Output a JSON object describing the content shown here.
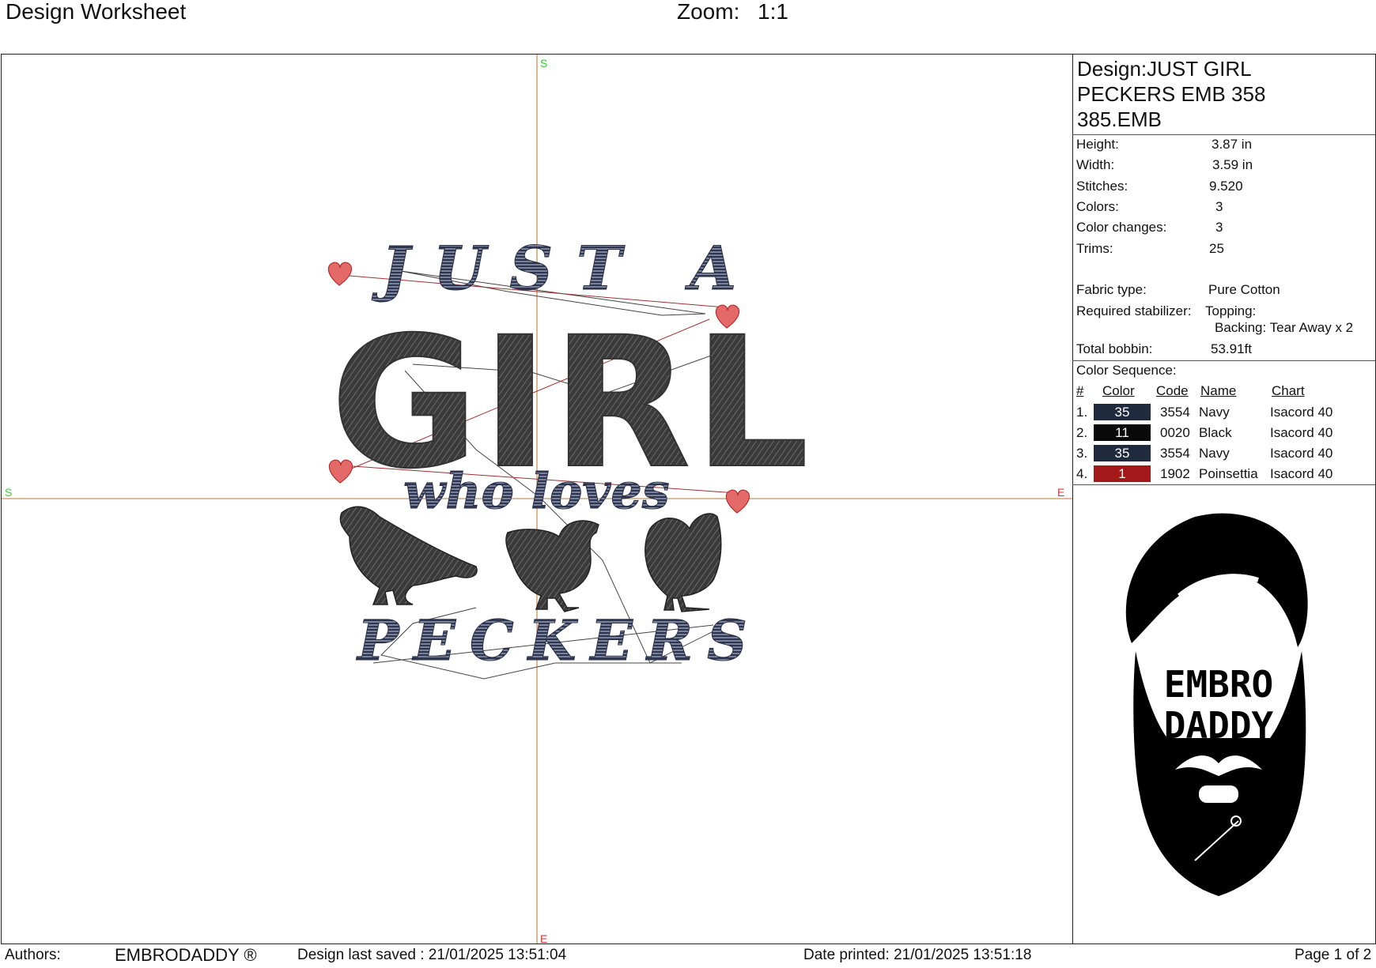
{
  "header": {
    "title": "Design Worksheet",
    "zoom_label": "Zoom:",
    "zoom_value": "1:1"
  },
  "canvas": {
    "axis_markers": {
      "top": "S",
      "bottom": "E",
      "left": "S",
      "right": "E"
    },
    "design_text": {
      "line1": "JUST A",
      "line2": "GIRL",
      "line3": "who loves",
      "line4": "PECKERS"
    }
  },
  "details": {
    "design_label": "Design:",
    "design_name_lines": [
      "JUST GIRL",
      "PECKERS EMB 358",
      "385.EMB"
    ],
    "height": {
      "label": "Height:",
      "value": "3.87 in"
    },
    "width": {
      "label": "Width:",
      "value": "3.59 in"
    },
    "stitches": {
      "label": "Stitches:",
      "value": "9.520"
    },
    "colors": {
      "label": "Colors:",
      "value": "3"
    },
    "color_changes": {
      "label": "Color changes:",
      "value": "3"
    },
    "trims": {
      "label": "Trims:",
      "value": "25"
    },
    "fabric": {
      "label": "Fabric type:",
      "value": "Pure Cotton"
    },
    "stabilizer": {
      "label": "Required stabilizer:",
      "topping": "Topping:",
      "backing": "Backing: Tear Away x 2"
    },
    "bobbin": {
      "label": "Total bobbin:",
      "value": "53.91ft"
    }
  },
  "color_sequence": {
    "title": "Color Sequence:",
    "headers": {
      "num": "#",
      "color": "Color",
      "code": "Code",
      "name": "Name",
      "chart": "Chart"
    },
    "rows": [
      {
        "num": "1.",
        "swatch": "35",
        "swatch_color": "#1f2a3e",
        "code": "3554",
        "name": "Navy",
        "chart": "Isacord 40"
      },
      {
        "num": "2.",
        "swatch": "11",
        "swatch_color": "#0a0a0a",
        "code": "0020",
        "name": "Black",
        "chart": "Isacord 40"
      },
      {
        "num": "3.",
        "swatch": "35",
        "swatch_color": "#1f2a3e",
        "code": "3554",
        "name": "Navy",
        "chart": "Isacord 40"
      },
      {
        "num": "4.",
        "swatch": "1",
        "swatch_color": "#a31818",
        "code": "1902",
        "name": "Poinsettia",
        "chart": "Isacord 40"
      }
    ]
  },
  "logo": {
    "line1": "EMBRO",
    "line2": "DADDY"
  },
  "footer": {
    "authors_label": "Authors:",
    "authors_value": "EMBRODADDY ®",
    "saved": "Design last saved : 21/01/2025 13:51:04",
    "printed": "Date printed: 21/01/2025 13:51:18",
    "page": "Page 1 of 2"
  }
}
